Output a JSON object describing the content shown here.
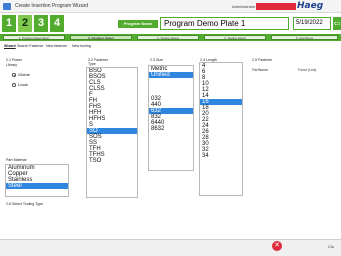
{
  "window": {
    "title": "Create Insertion Program Wizard",
    "admin_label": "Administrator",
    "brand": "Haeg"
  },
  "header": {
    "steps": [
      "1",
      "2",
      "3",
      "4"
    ],
    "program_name_label": "Program Name",
    "program_name_value": "Program Demo Plate 1",
    "date_value": "5/19/2022",
    "next_icon": "arrow-right-icon"
  },
  "tabs": [
    {
      "label": "1. Program Description"
    },
    {
      "label": "2. Fastener Select"
    },
    {
      "label": "3. Tooling Select"
    },
    {
      "label": "4. Tooling Select"
    },
    {
      "label": "5. Add Steps"
    }
  ],
  "subtabs": [
    {
      "label": "Wizard"
    },
    {
      "label": "Search Fastener"
    },
    {
      "label": "New fastener"
    },
    {
      "label": "New tooling"
    }
  ],
  "power": {
    "title": "2.1 Power",
    "library_label": "Library",
    "options": [
      {
        "label": "Global",
        "checked": true
      },
      {
        "label": "Local",
        "checked": false
      }
    ]
  },
  "fastener_type": {
    "title": "2.2 Fastener",
    "subtitle": "Type",
    "items": [
      "BSO",
      "BSOS",
      "CLS",
      "CLSS",
      "F",
      "FH",
      "FHS",
      "HFH",
      "HFHS",
      "S",
      "SO",
      "SOS",
      "SS",
      "TFH",
      "TFHS",
      "TSO"
    ],
    "selected": "SO"
  },
  "part_material": {
    "title": "Part Material",
    "items": [
      "Aluminum",
      "Copper",
      "Stainless",
      "Steel"
    ],
    "selected": "Steel"
  },
  "size": {
    "title": "2.3 Size",
    "items": [
      "Metric",
      "Unified",
      "",
      "",
      "",
      "032",
      "440",
      "632",
      "832",
      "6440",
      "8632"
    ],
    "selected": [
      "Unified",
      "632"
    ]
  },
  "length": {
    "title": "2.4 Length",
    "items": [
      "4",
      "6",
      "8",
      "10",
      "12",
      "14",
      "16",
      "18",
      "20",
      "22",
      "24",
      "26",
      "28",
      "30",
      "32",
      "34"
    ],
    "selected": "16"
  },
  "fastener_table": {
    "title": "2.5 Fastener",
    "columns": [
      "PartName",
      "Force (Lbs)"
    ]
  },
  "tooling": {
    "title": "2.6 Select Tooling Type"
  },
  "footer": {
    "cancel_icon": "cancel-icon",
    "close_label": "Clo"
  }
}
